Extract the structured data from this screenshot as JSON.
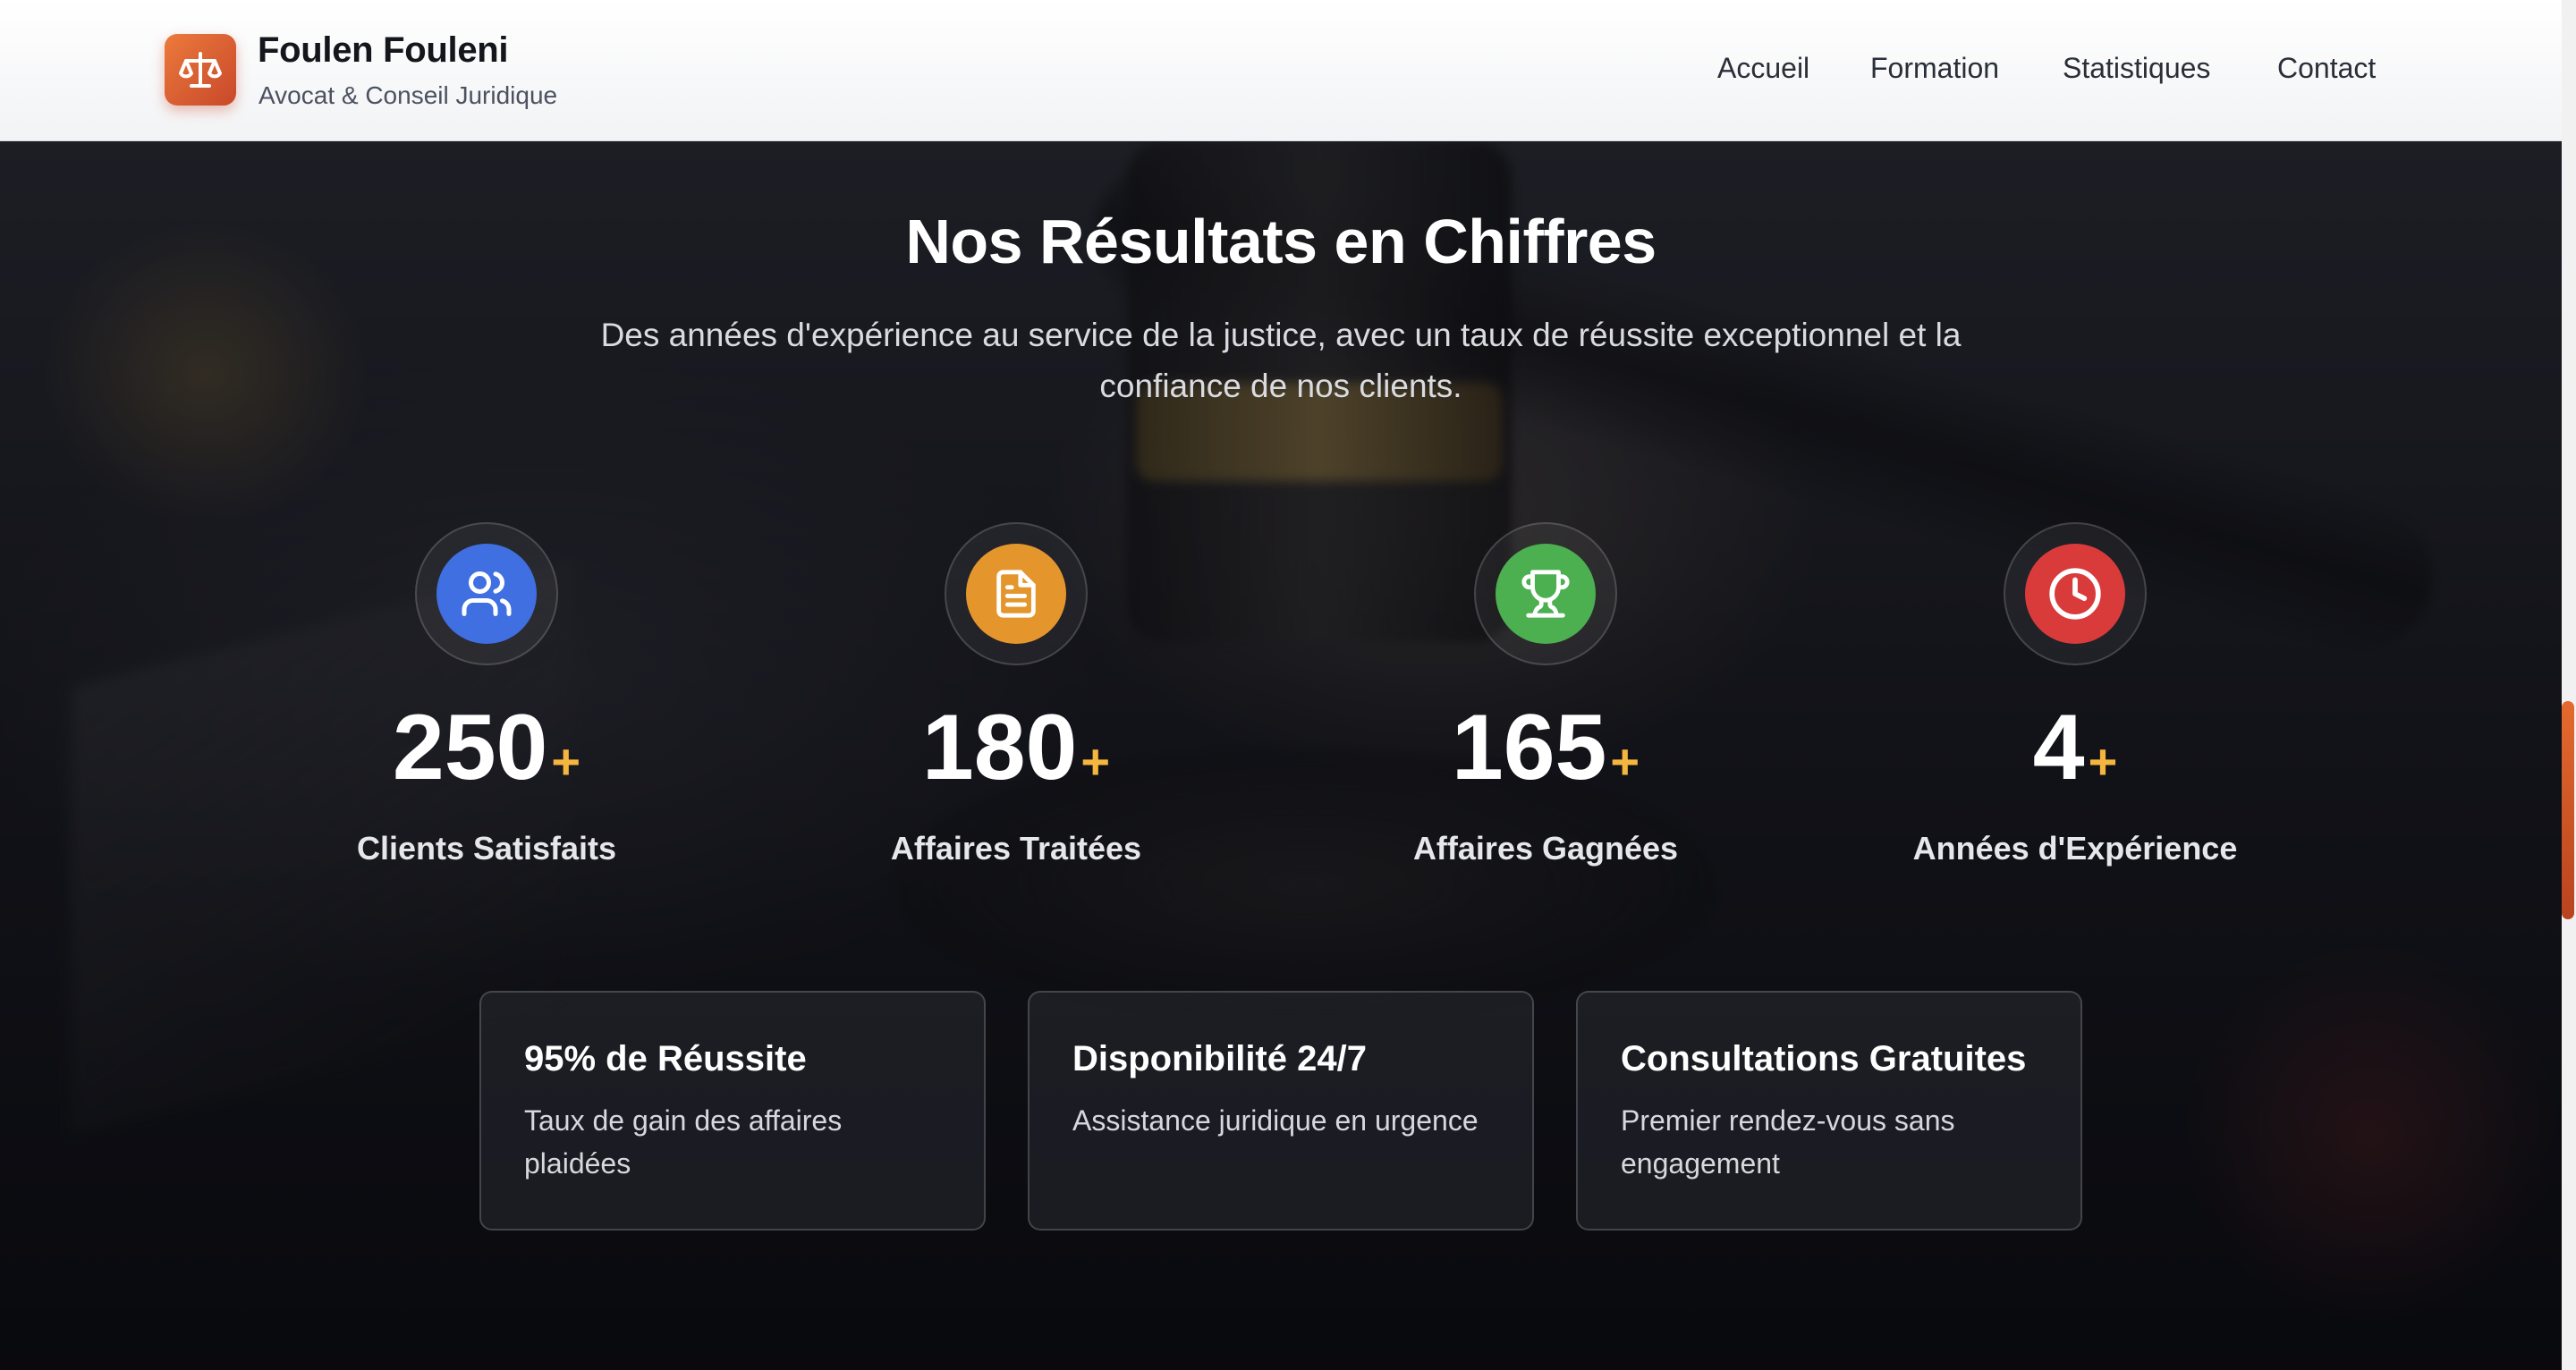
{
  "brand": {
    "name": "Foulen Fouleni",
    "tagline": "Avocat & Conseil Juridique",
    "logo_icon": "scales-icon"
  },
  "nav": {
    "items": [
      {
        "label": "Accueil"
      },
      {
        "label": "Formation"
      },
      {
        "label": "Statistiques"
      },
      {
        "label": "Contact"
      }
    ]
  },
  "section": {
    "title": "Nos Résultats en Chiffres",
    "subtitle": "Des années d'expérience au service de la justice, avec un taux de réussite exceptionnel et la confiance de nos clients."
  },
  "stats": [
    {
      "value": "250",
      "suffix": "+",
      "label": "Clients Satisfaits",
      "icon": "users-icon",
      "color": "#3f6fe0"
    },
    {
      "value": "180",
      "suffix": "+",
      "label": "Affaires Traitées",
      "icon": "document-icon",
      "color": "#e4962d"
    },
    {
      "value": "165",
      "suffix": "+",
      "label": "Affaires Gagnées",
      "icon": "trophy-icon",
      "color": "#4caf50"
    },
    {
      "value": "4",
      "suffix": "+",
      "label": "Années d'Expérience",
      "icon": "clock-icon",
      "color": "#d93b3b"
    }
  ],
  "cards": [
    {
      "title": "95% de Réussite",
      "text": "Taux de gain des affaires plaidées"
    },
    {
      "title": "Disponibilité 24/7",
      "text": "Assistance juridique en urgence"
    },
    {
      "title": "Consultations Gratuites",
      "text": "Premier rendez-vous sans engagement"
    }
  ],
  "colors": {
    "accent": "#e4962d",
    "plus": "#f4b63f",
    "brand": "#d9582f"
  }
}
